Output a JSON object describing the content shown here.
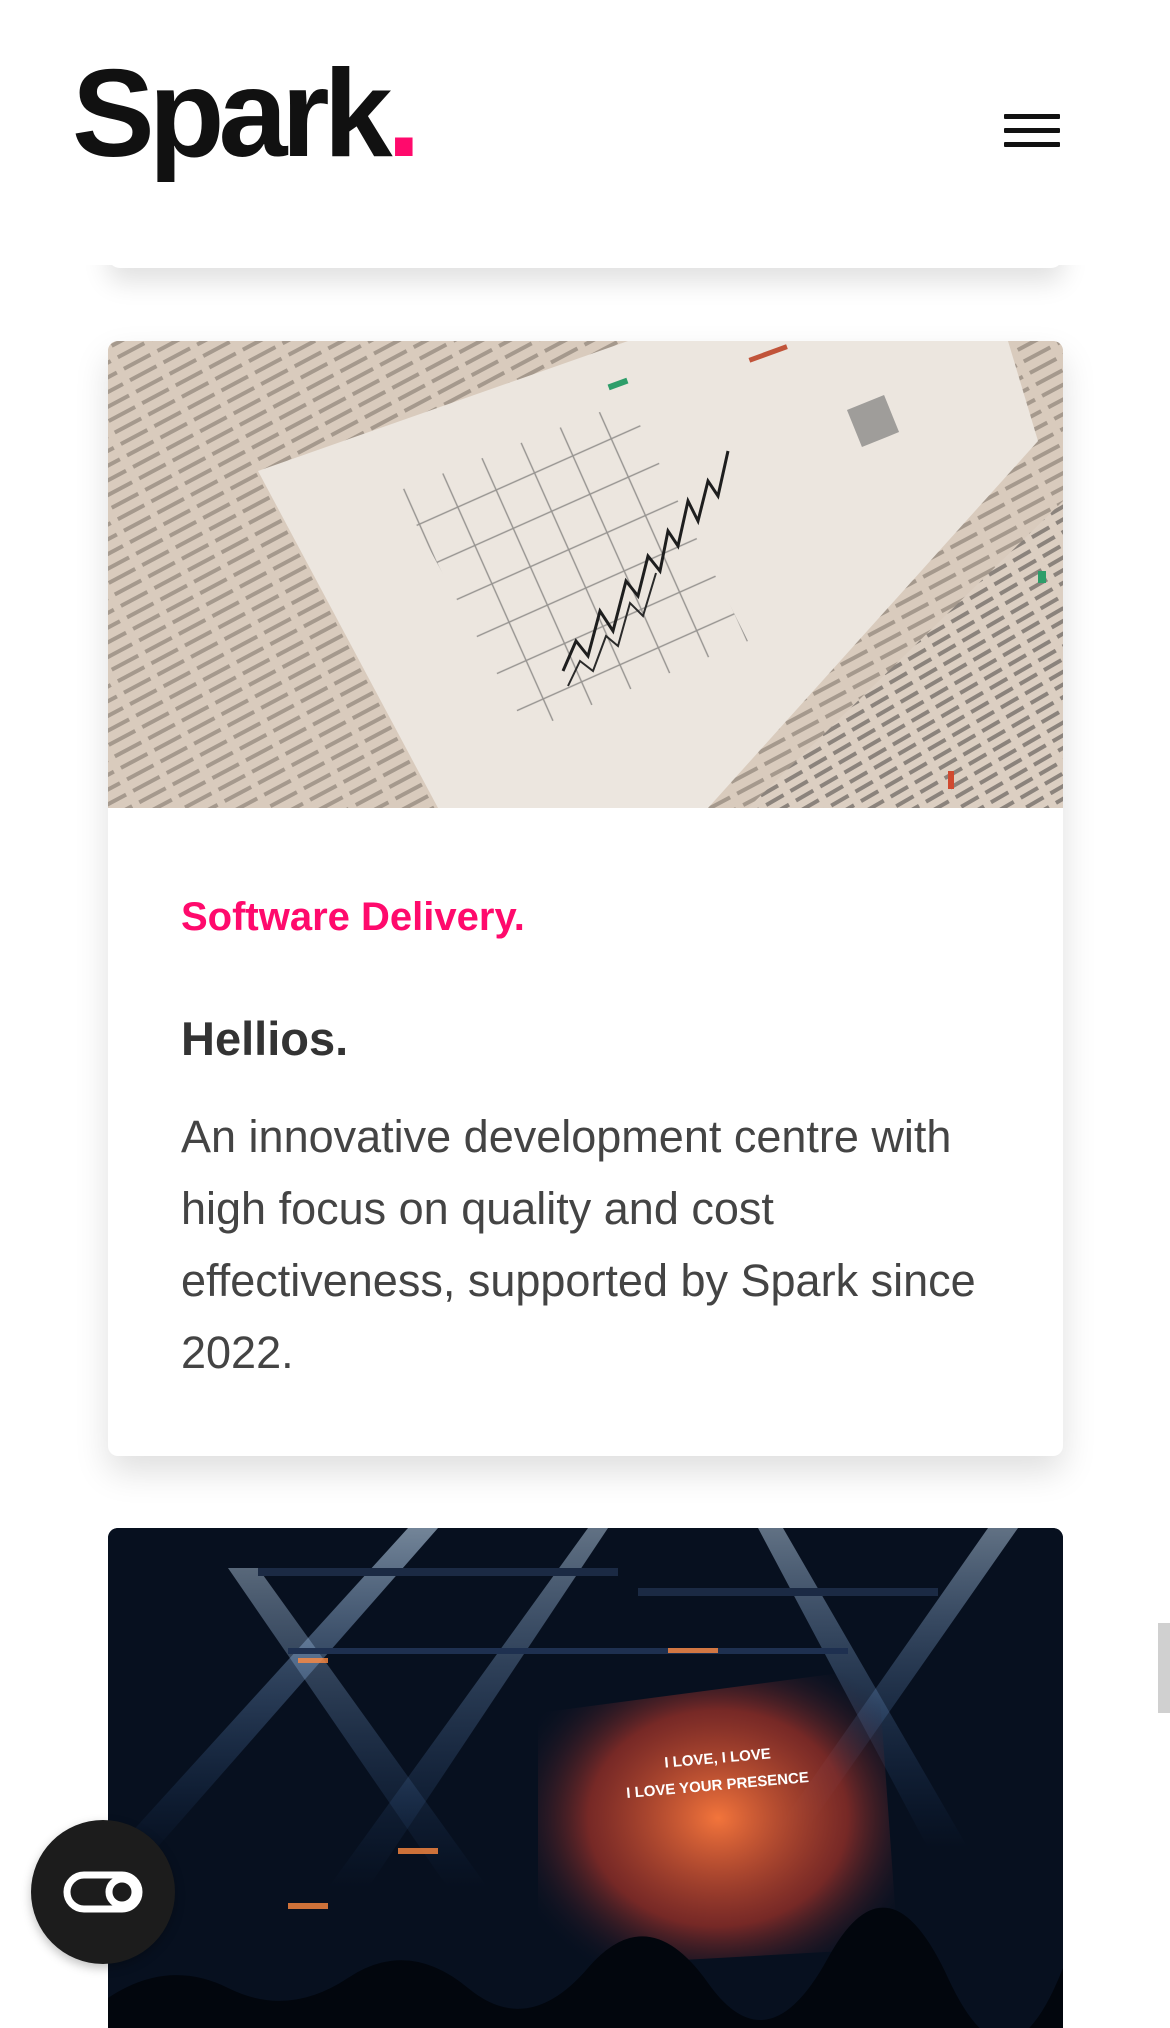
{
  "header": {
    "logo_text": "Spark",
    "logo_dot": ".",
    "menu_icon": "hamburger-menu-icon",
    "accent_color": "#ff0a6c"
  },
  "card": {
    "image_alt": "Stock chart printout on newspaper financial pages",
    "category": "Software Delivery.",
    "title": "Hellios.",
    "description": "An innovative development centre with high focus on quality and cost effectiveness, supported by Spark since 2022."
  },
  "next_card": {
    "image_alt": "Concert stage with blue stage lights and screen",
    "screen_text_line1": "I LOVE, I LOVE",
    "screen_text_line2": "I LOVE YOUR PRESENCE"
  },
  "accessibility_button": {
    "icon": "accessibility-toggle-icon"
  }
}
